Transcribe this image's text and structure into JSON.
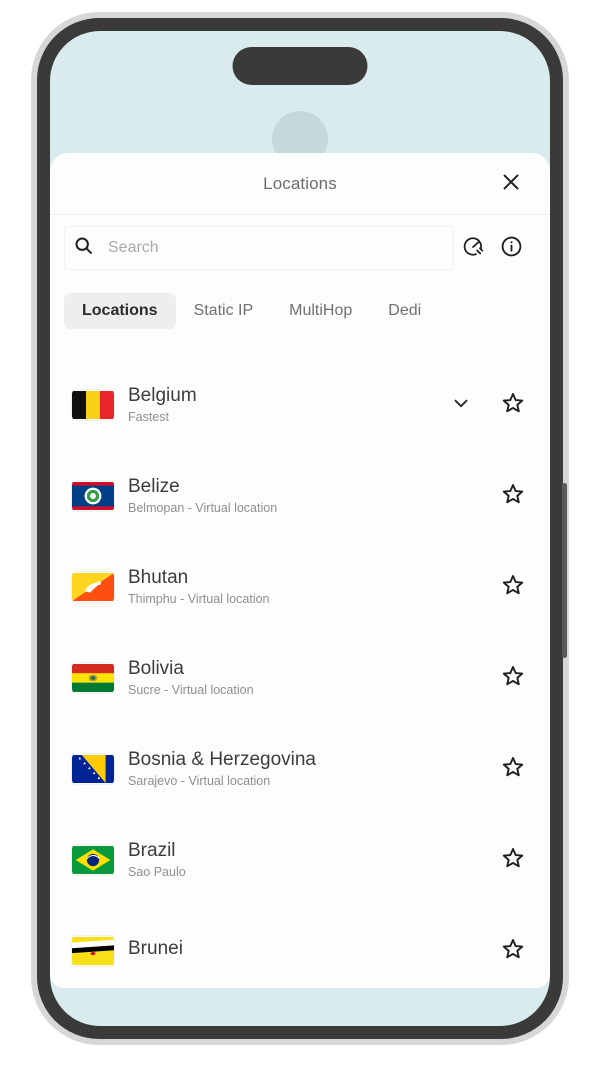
{
  "app": {
    "background_color": "#d9ebec",
    "panel_color": "#fdfdfd"
  },
  "header": {
    "title": "Locations",
    "close_icon": "close-icon"
  },
  "search": {
    "icon": "search-icon",
    "value": "",
    "placeholder": "Search",
    "actions": [
      {
        "name": "speed-test-icon",
        "label": "Speed test"
      },
      {
        "name": "info-icon",
        "label": "Info"
      }
    ]
  },
  "tabs": [
    {
      "label": "Locations",
      "active": true
    },
    {
      "label": "Static IP",
      "active": false
    },
    {
      "label": "MultiHop",
      "active": false
    },
    {
      "label": "Dedi",
      "active": false
    }
  ],
  "locations": [
    {
      "name": "Belgium",
      "subtitle": "Fastest",
      "flag": "flag-belgium",
      "expandable": true,
      "favorite": false,
      "chevron_icon": "chevron-down-icon",
      "star_icon": "star-outline-icon"
    },
    {
      "name": "Belize",
      "subtitle": "Belmopan - Virtual location",
      "flag": "flag-belize",
      "expandable": false,
      "favorite": false,
      "star_icon": "star-outline-icon"
    },
    {
      "name": "Bhutan",
      "subtitle": "Thimphu - Virtual location",
      "flag": "flag-bhutan",
      "expandable": false,
      "favorite": false,
      "star_icon": "star-outline-icon"
    },
    {
      "name": "Bolivia",
      "subtitle": "Sucre - Virtual location",
      "flag": "flag-bolivia",
      "expandable": false,
      "favorite": false,
      "star_icon": "star-outline-icon"
    },
    {
      "name": "Bosnia & Herzegovina",
      "subtitle": "Sarajevo - Virtual location",
      "flag": "flag-bosnia",
      "expandable": false,
      "favorite": false,
      "star_icon": "star-outline-icon"
    },
    {
      "name": "Brazil",
      "subtitle": "Sao Paulo",
      "flag": "flag-brazil",
      "expandable": false,
      "favorite": false,
      "star_icon": "star-outline-icon"
    },
    {
      "name": "Brunei",
      "subtitle": "",
      "flag": "flag-brunei",
      "expandable": false,
      "favorite": false,
      "star_icon": "star-outline-icon"
    }
  ]
}
